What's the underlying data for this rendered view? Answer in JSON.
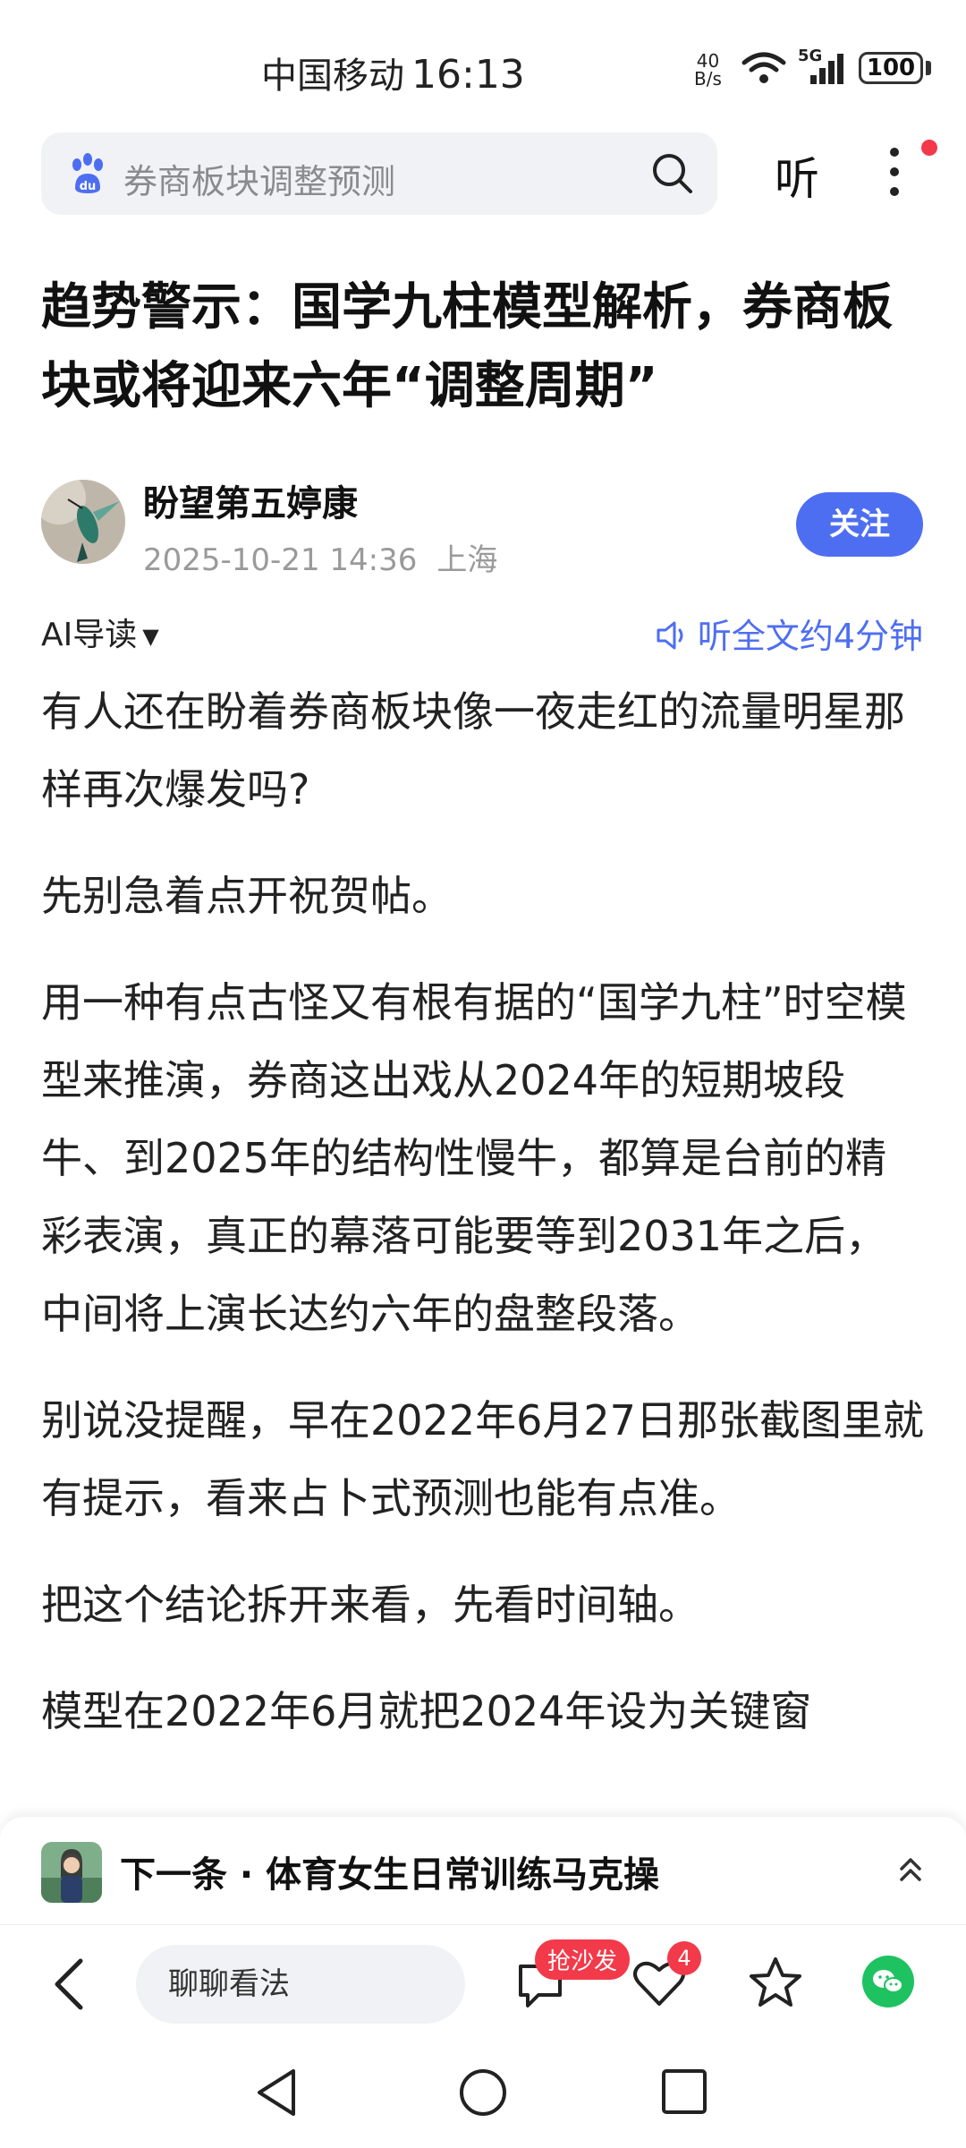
{
  "status_bar": {
    "carrier": "中国移动",
    "time": "16:13",
    "net_speed_value": "40",
    "net_speed_unit": "B/s",
    "network": "5G",
    "battery": "100"
  },
  "top_bar": {
    "search_text": "券商板块调整预测",
    "listen_label": "听",
    "accent_color": "#4e6ef2",
    "badge_color": "#f23a4a"
  },
  "article": {
    "title": "趋势警示：国学九柱模型解析，券商板块或将迎来六年“调整周期”",
    "author": {
      "name": "盼望第五婷康",
      "date": "2025-10-21 14:36",
      "location": "上海",
      "follow_label": "关注"
    },
    "ai_guide_label": "AI导读",
    "listen_full_label": "听全文约4分钟",
    "paragraphs": [
      "有人还在盼着券商板块像一夜走红的流量明星那样再次爆发吗?",
      "先别急着点开祝贺帖。",
      "用一种有点古怪又有根有据的“国学九柱”时空模型来推演，券商这出戏从2024年的短期坡段牛、到2025年的结构性慢牛，都算是台前的精彩表演，真正的幕落可能要等到2031年之后，中间将上演长达约六年的盘整段落。",
      "别说没提醒，早在2022年6月27日那张截图里就有提示，看来占卜式预测也能有点准。",
      "把这个结论拆开来看，先看时间轴。",
      "模型在2022年6月就把2024年设为关键窗"
    ]
  },
  "next_item": {
    "label": "下一条 · 体育女生日常训练马克操"
  },
  "bottom_bar": {
    "comment_placeholder": "聊聊看法",
    "sofa_badge": "抢沙发",
    "like_count": "4"
  }
}
